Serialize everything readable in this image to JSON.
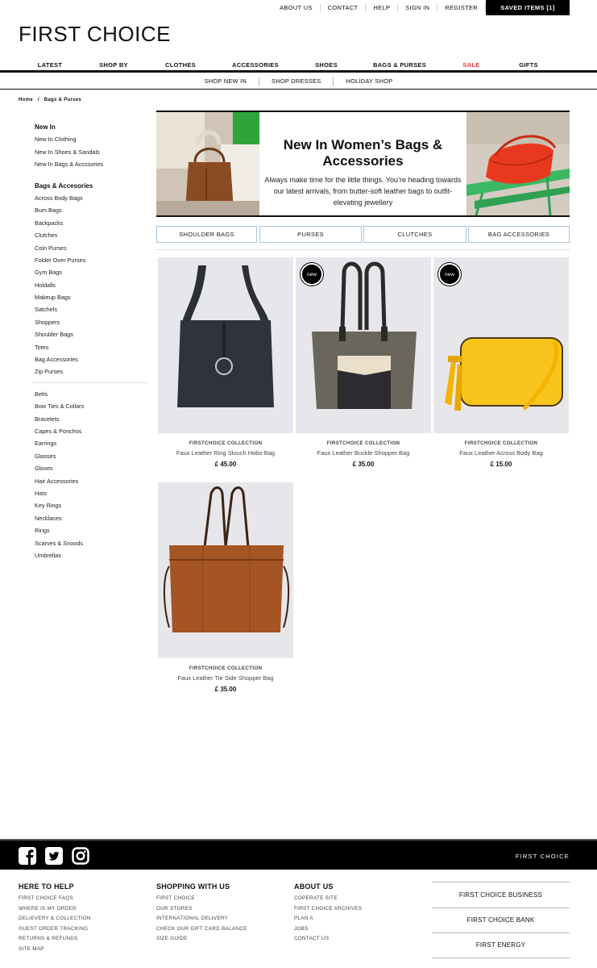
{
  "util_links": [
    "ABOUT US",
    "CONTACT",
    "HELP",
    "SIGN IN",
    "REGISTER"
  ],
  "saved_items": "SAVED ITEMS [1]",
  "logo": "FIRST CHOICE",
  "main_nav": [
    "LATEST",
    "SHOP BY",
    "CLOTHES",
    "ACCESSORIES",
    "SHOES",
    "BAGS & PURSES",
    "SALE",
    "GIFTS"
  ],
  "sale_color": "#e8343a",
  "sub_nav": [
    "SHOP NEW IN",
    "SHOP DRESSES",
    "HOLIDAY SHOP"
  ],
  "breadcrumb": {
    "home": "Home",
    "sep": "/",
    "current": "Bags & Purses"
  },
  "sidebar": {
    "new_in_heading": "New In",
    "new_in_items": [
      "New In Clothing",
      "New In Shoes & Sandals",
      "New In Bags & Accssories"
    ],
    "bags_heading": "Bags & Accesories",
    "bags_items": [
      "Across Body Bags",
      "Bum Bags",
      "Backpacks",
      "Clutches",
      "Coin Purses",
      "Folder Over Purses",
      "Gym Bags",
      "Holdalls",
      "Makeup Bags",
      "Satchels",
      "Shoppers",
      "Shoulder Bags",
      "Totes",
      "Bag Accessories",
      "Zip Purses"
    ],
    "acc_items": [
      "Belts",
      "Bow Ties & Collars",
      "Bracelets",
      "Capes & Ponchos",
      "Earrings",
      "Glasses",
      "Gloves",
      "Hair Accessories",
      "Hats",
      "Key Rings",
      "Necklaces",
      "Rings",
      "Scarves & Snoods",
      "Umbrellas"
    ]
  },
  "hero": {
    "title": "New In Women’s Bags & Accessories",
    "subtitle": "Always make time for the little things. You’re heading towards our latest arrivals, from butter-soft leather bags to outfit-elevating jewellery"
  },
  "categories": [
    "SHOULDER BAGS",
    "PURSES",
    "CLUTCHES",
    "BAG ACCESSORIES"
  ],
  "products": [
    {
      "brand": "FIRSTCHOICE COLLECTION",
      "name": "Faux Leather Ring Slouch Hobo Bag",
      "price": "£ 45.00",
      "badge": ""
    },
    {
      "brand": "FIRSTCHOICE COLLECTION",
      "name": "Faux Leather Buckle Shopper Bag",
      "price": "£ 35.00",
      "badge": "new"
    },
    {
      "brand": "FIRSTCHOICE COLLECTION",
      "name": "Faux Leather Across Body Bag",
      "price": "£ 15.00",
      "badge": "new"
    },
    {
      "brand": "FIRSTCHOICE COLLECTION",
      "name": "Faux Leather Tie Side Shopper Bag",
      "price": "£ 35.00",
      "badge": ""
    }
  ],
  "footer": {
    "social_icons": [
      "facebook-icon",
      "twitter-icon",
      "instagram-icon"
    ],
    "brand": "FIRST  CHOICE",
    "help_heading": "HERE TO HELP",
    "help_links": [
      "FIRST CHOICE FAQS",
      "WHERE IS MY ORDER",
      "DELIEVERY & COLLECTION",
      "GUEST ORDER TRACKING",
      "RETURNS & REFUNDS",
      "SITE MAP"
    ],
    "shop_heading": "SHOPPING WITH US",
    "shop_links": [
      "FIRST CHOICE",
      "OUR STORES",
      "INTERNATIONAL DELIVERY",
      "CHECK OUR GIFT CARD BALANCE",
      "SIZE GUIDE"
    ],
    "about_heading": "ABOUT US",
    "about_links": [
      "COPERATE SITE",
      "FIRST CHOICE ARCHIVES",
      "PLAN A",
      "JOBS",
      "CONTACT US"
    ],
    "group_links": [
      "FIRST CHOICE BUSINESS",
      "FIRST CHOICE BANK",
      "FIRST ENERGY"
    ]
  }
}
